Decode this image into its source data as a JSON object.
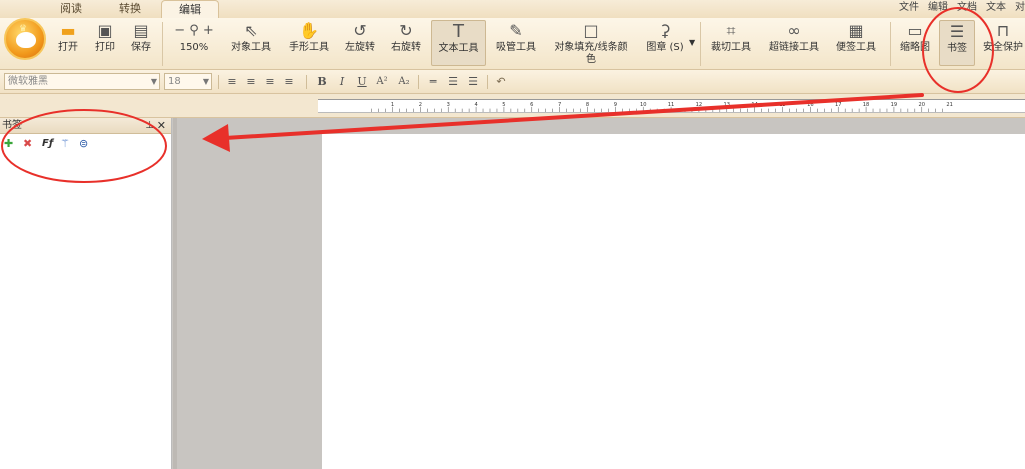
{
  "tabs": [
    {
      "label": "阅读",
      "active": false
    },
    {
      "label": "转换",
      "active": false
    },
    {
      "label": "编辑",
      "active": true
    }
  ],
  "menu": [
    "文件",
    "编辑",
    "文档",
    "文本",
    "对"
  ],
  "toolbar": {
    "open": "打开",
    "print": "打印",
    "save": "保存",
    "zoom": "150%",
    "object_tool": "对象工具",
    "hand_tool": "手形工具",
    "rotate_left": "左旋转",
    "rotate_right": "右旋转",
    "text_tool": "文本工具",
    "eyedropper": "吸管工具",
    "object_fill_line1": "对象填充/线条颜",
    "object_fill_line2": "色",
    "stamp": "图章 (S)",
    "crop_tool": "裁切工具",
    "hyperlink_tool": "超链接工具",
    "sticky_note": "便签工具",
    "thumbnail": "缩略图",
    "bookmark": "书签",
    "security": "安全保护"
  },
  "format": {
    "font": "微软雅黑",
    "size": "18",
    "bold": "B",
    "italic": "I",
    "underline": "U",
    "superscript": "A²",
    "subscript": "A₂"
  },
  "ruler": {
    "ticks": [
      "1",
      "2",
      "3",
      "4",
      "5",
      "6",
      "7",
      "8",
      "9",
      "10",
      "11",
      "12",
      "13",
      "14",
      "15",
      "16",
      "17",
      "18",
      "19",
      "20",
      "21"
    ]
  },
  "bookmark_panel": {
    "title": "书签"
  },
  "colors": {
    "annotation_red": "#e8302a",
    "ribbon_bg": "#f7ebd3"
  }
}
